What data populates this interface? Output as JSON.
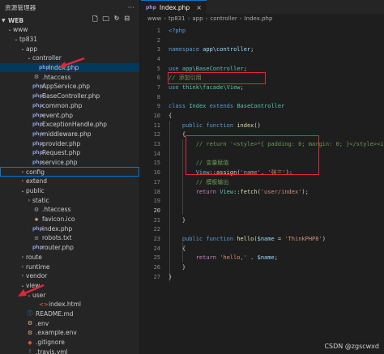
{
  "explorer": {
    "title": "资源管理器",
    "root_label": "WEB",
    "tree": [
      {
        "label": "www",
        "indent": 0,
        "arrow": "v",
        "icon": ""
      },
      {
        "label": "tp831",
        "indent": 1,
        "arrow": "v",
        "icon": ""
      },
      {
        "label": "app",
        "indent": 2,
        "arrow": "v",
        "icon": ""
      },
      {
        "label": "controller",
        "indent": 3,
        "arrow": "v",
        "icon": ""
      },
      {
        "label": "Index.php",
        "indent": 4,
        "arrow": "",
        "icon": "php",
        "selected": true
      },
      {
        "label": ".htaccess",
        "indent": 3,
        "arrow": "",
        "icon": "dot"
      },
      {
        "label": "AppService.php",
        "indent": 3,
        "arrow": "",
        "icon": "php"
      },
      {
        "label": "BaseController.php",
        "indent": 3,
        "arrow": "",
        "icon": "php"
      },
      {
        "label": "common.php",
        "indent": 3,
        "arrow": "",
        "icon": "php"
      },
      {
        "label": "event.php",
        "indent": 3,
        "arrow": "",
        "icon": "php"
      },
      {
        "label": "ExceptionHandle.php",
        "indent": 3,
        "arrow": "",
        "icon": "php"
      },
      {
        "label": "middleware.php",
        "indent": 3,
        "arrow": "",
        "icon": "php"
      },
      {
        "label": "provider.php",
        "indent": 3,
        "arrow": "",
        "icon": "php"
      },
      {
        "label": "Request.php",
        "indent": 3,
        "arrow": "",
        "icon": "php"
      },
      {
        "label": "service.php",
        "indent": 3,
        "arrow": "",
        "icon": "php"
      },
      {
        "label": "config",
        "indent": 2,
        "arrow": ">",
        "icon": "",
        "outlined": true
      },
      {
        "label": "extend",
        "indent": 2,
        "arrow": ">",
        "icon": ""
      },
      {
        "label": "public",
        "indent": 2,
        "arrow": "v",
        "icon": ""
      },
      {
        "label": "static",
        "indent": 3,
        "arrow": ">",
        "icon": ""
      },
      {
        "label": ".htaccess",
        "indent": 3,
        "arrow": "",
        "icon": "dot"
      },
      {
        "label": "favicon.ico",
        "indent": 3,
        "arrow": "",
        "icon": "star"
      },
      {
        "label": "index.php",
        "indent": 3,
        "arrow": "",
        "icon": "php"
      },
      {
        "label": "robots.txt",
        "indent": 3,
        "arrow": "",
        "icon": "txt"
      },
      {
        "label": "router.php",
        "indent": 3,
        "arrow": "",
        "icon": "php"
      },
      {
        "label": "route",
        "indent": 2,
        "arrow": ">",
        "icon": ""
      },
      {
        "label": "runtime",
        "indent": 2,
        "arrow": ">",
        "icon": ""
      },
      {
        "label": "vendor",
        "indent": 2,
        "arrow": ">",
        "icon": ""
      },
      {
        "label": "view",
        "indent": 2,
        "arrow": "v",
        "icon": ""
      },
      {
        "label": "user",
        "indent": 3,
        "arrow": "v",
        "icon": ""
      },
      {
        "label": "index.html",
        "indent": 4,
        "arrow": "",
        "icon": "html"
      },
      {
        "label": "README.md",
        "indent": 2,
        "arrow": "",
        "icon": "md"
      },
      {
        "label": ".env",
        "indent": 2,
        "arrow": "",
        "icon": "env"
      },
      {
        "label": ".example.env",
        "indent": 2,
        "arrow": "",
        "icon": "env"
      },
      {
        "label": ".gitignore",
        "indent": 2,
        "arrow": "",
        "icon": "git"
      },
      {
        "label": ".travis.yml",
        "indent": 2,
        "arrow": "",
        "icon": "yml"
      }
    ]
  },
  "editor": {
    "tab_label": "Index.php",
    "breadcrumbs": [
      "www",
      "tp831",
      "app",
      "controller",
      "Index.php"
    ],
    "current_line": 20,
    "lines": [
      [
        [
          "kw",
          "<?php"
        ]
      ],
      [],
      [
        [
          "kw",
          "namespace"
        ],
        [
          "src",
          " "
        ],
        [
          "var",
          "app\\controller"
        ],
        [
          "src",
          ";"
        ]
      ],
      [],
      [
        [
          "kw",
          "use"
        ],
        [
          "src",
          " "
        ],
        [
          "cls",
          "app\\BaseController"
        ],
        [
          "src",
          ";"
        ]
      ],
      [
        [
          "cm",
          "// 添加引用"
        ]
      ],
      [
        [
          "kw",
          "use"
        ],
        [
          "src",
          " "
        ],
        [
          "cls",
          "think\\facade\\View"
        ],
        [
          "src",
          ";"
        ]
      ],
      [],
      [
        [
          "kw",
          "class"
        ],
        [
          "src",
          " "
        ],
        [
          "cls",
          "Index"
        ],
        [
          "src",
          " "
        ],
        [
          "kw",
          "extends"
        ],
        [
          "src",
          " "
        ],
        [
          "cls",
          "BaseController"
        ]
      ],
      [
        [
          "src",
          "{"
        ]
      ],
      [
        [
          "src",
          "    "
        ],
        [
          "kw",
          "public"
        ],
        [
          "src",
          " "
        ],
        [
          "kw",
          "function"
        ],
        [
          "src",
          " "
        ],
        [
          "fn",
          "index"
        ],
        [
          "src",
          "()"
        ]
      ],
      [
        [
          "src",
          "    {"
        ]
      ],
      [
        [
          "src",
          "        "
        ],
        [
          "cm",
          "// return '<style>*{ padding: 0; margin: 0; }</style><ifr"
        ]
      ],
      [],
      [
        [
          "src",
          "        "
        ],
        [
          "cm",
          "// 变量赋值"
        ]
      ],
      [
        [
          "src",
          "        "
        ],
        [
          "cls",
          "View"
        ],
        [
          "src",
          "::"
        ],
        [
          "fn",
          "assign"
        ],
        [
          "src",
          "("
        ],
        [
          "str",
          "'name'"
        ],
        [
          "src",
          ", "
        ],
        [
          "str",
          "'张三'"
        ],
        [
          "src",
          ");"
        ]
      ],
      [
        [
          "src",
          "        "
        ],
        [
          "cm",
          "// 模板输出"
        ]
      ],
      [
        [
          "src",
          "        "
        ],
        [
          "ctl",
          "return"
        ],
        [
          "src",
          " "
        ],
        [
          "cls",
          "View"
        ],
        [
          "src",
          "::"
        ],
        [
          "fn",
          "fetch"
        ],
        [
          "src",
          "("
        ],
        [
          "str",
          "'user/index'"
        ],
        [
          "src",
          ");"
        ]
      ],
      [],
      [],
      [
        [
          "src",
          "    }"
        ]
      ],
      [],
      [
        [
          "src",
          "    "
        ],
        [
          "kw",
          "public"
        ],
        [
          "src",
          " "
        ],
        [
          "kw",
          "function"
        ],
        [
          "src",
          " "
        ],
        [
          "fn",
          "hello"
        ],
        [
          "src",
          "("
        ],
        [
          "var",
          "$name"
        ],
        [
          "src",
          " = "
        ],
        [
          "str",
          "'ThinkPHP8'"
        ],
        [
          "src",
          ")"
        ]
      ],
      [
        [
          "src",
          "    {"
        ]
      ],
      [
        [
          "src",
          "        "
        ],
        [
          "ctl",
          "return"
        ],
        [
          "src",
          " "
        ],
        [
          "str",
          "'hello,'"
        ],
        [
          "src",
          " . "
        ],
        [
          "var",
          "$name"
        ],
        [
          "src",
          ";"
        ]
      ],
      [
        [
          "src",
          "    }"
        ]
      ],
      [
        [
          "src",
          "}"
        ]
      ]
    ]
  },
  "watermark": "CSDN @zgscwxd",
  "colors": {
    "highlight": "#e0283a",
    "selection": "#04395e",
    "accent": "#0078d4"
  }
}
